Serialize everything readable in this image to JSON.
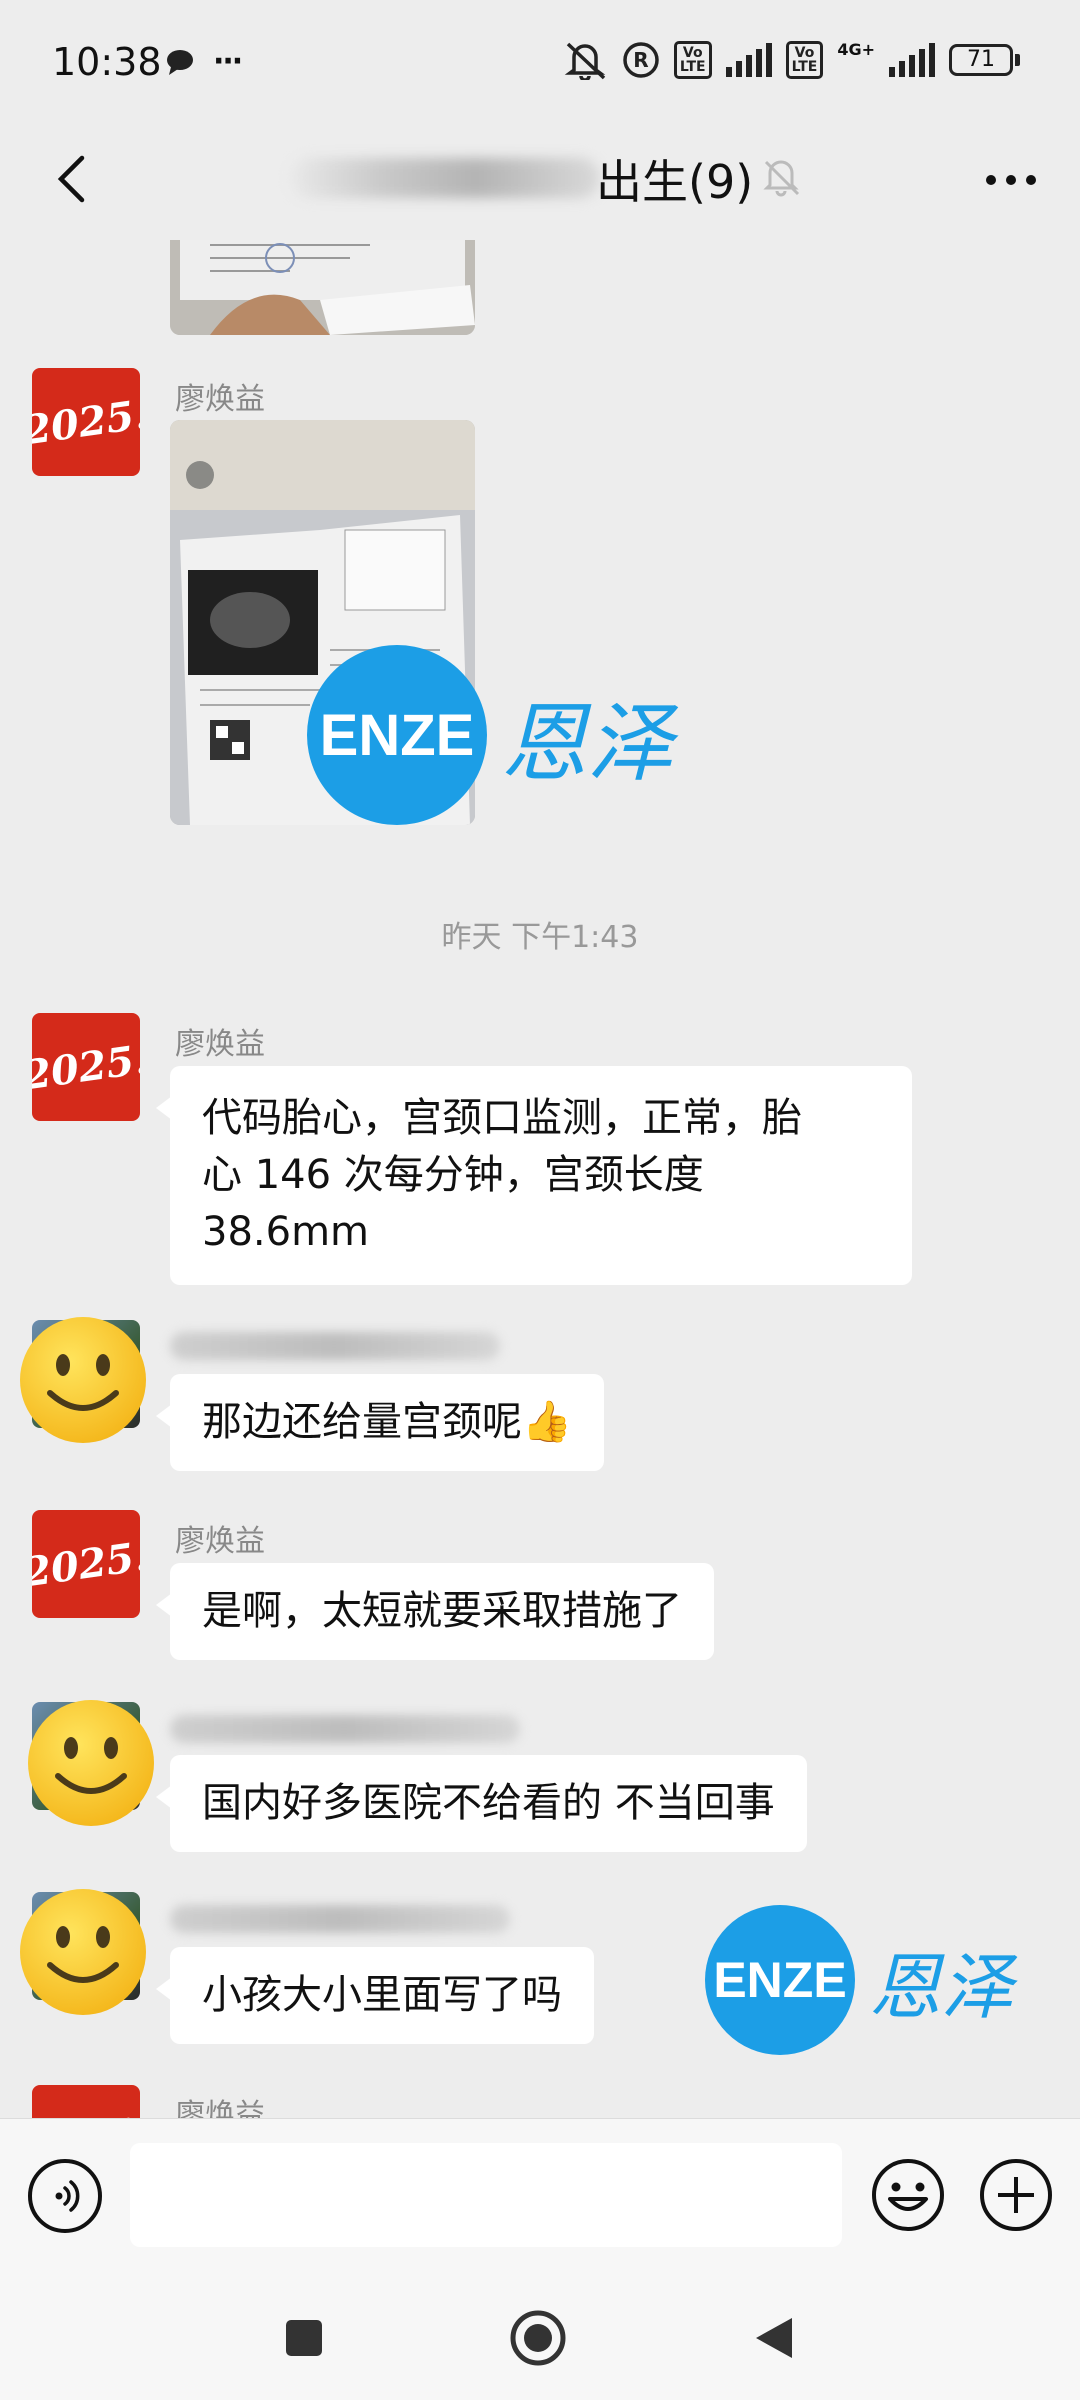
{
  "status_bar": {
    "time": "10:38",
    "more": "···",
    "network": "4G+",
    "volte": "Vo LTE",
    "battery": "71"
  },
  "header": {
    "title": "出生(9)"
  },
  "messages": [
    {
      "type": "image",
      "sender": "",
      "description_icon": "document-photo"
    },
    {
      "type": "image",
      "sender": "廖焕益"
    },
    {
      "type": "timestamp",
      "text": "昨天 下午1:43"
    },
    {
      "type": "text",
      "sender": "廖焕益",
      "lines": [
        "代码胎心，宫颈口监测，正常，胎",
        "心 146 次每分钟，宫颈长度",
        "38.6mm"
      ]
    },
    {
      "type": "text",
      "sender": "",
      "text": "那边还给量宫颈呢👍"
    },
    {
      "type": "text",
      "sender": "廖焕益",
      "text": "是啊，太短就要采取措施了"
    },
    {
      "type": "text",
      "sender": "",
      "text": "国内好多医院不给看的 不当回事"
    },
    {
      "type": "text",
      "sender": "",
      "text": "小孩大小里面写了吗"
    },
    {
      "type": "text",
      "sender": "廖焕益",
      "text": ""
    }
  ],
  "avatars": {
    "badge_text": "2025."
  },
  "watermark": {
    "logo": "ENZE",
    "text": "恩泽"
  },
  "input": {
    "placeholder": "",
    "value": ""
  },
  "colors": {
    "background": "#ededed",
    "bubble": "#ffffff",
    "watermark": "#1c9ee6",
    "avatar_red": "#d42a1a"
  }
}
